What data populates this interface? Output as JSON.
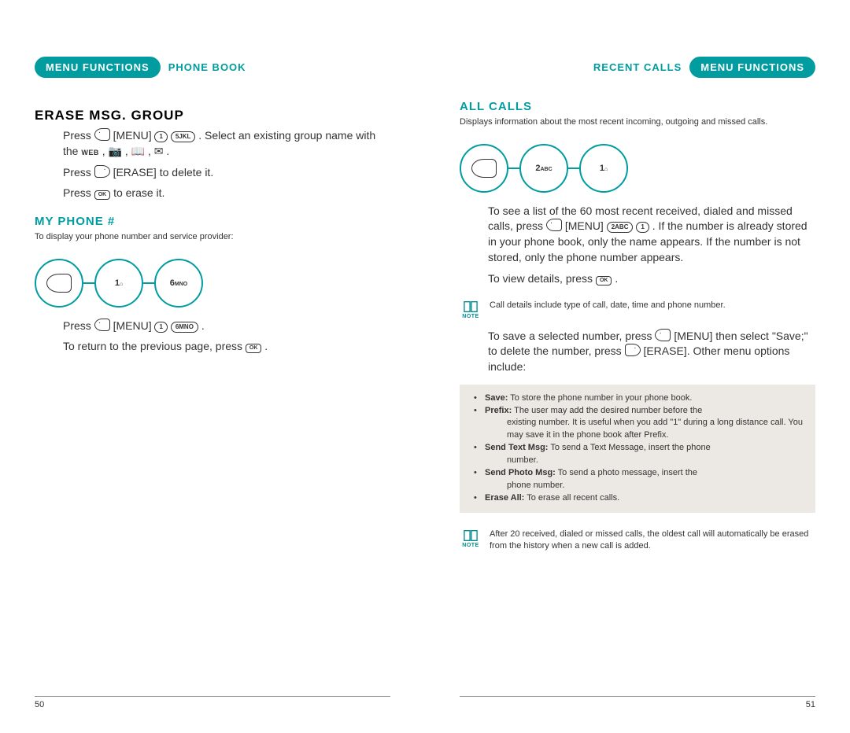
{
  "left": {
    "header_pill": "MENU FUNCTIONS",
    "header_breadcrumb": "PHONE BOOK",
    "s1": {
      "heading": "ERASE MSG. GROUP",
      "line1a": "Press ",
      "menu_word": "[MENU]",
      "line1b": " . Select an existing group name with the ",
      "web": "WEB",
      "line1c": " , ",
      "line2a": "Press ",
      "erase_word": "[ERASE]",
      "line2b": " to delete it.",
      "line3a": "Press ",
      "line3b": " to erase it."
    },
    "s2": {
      "heading": "MY PHONE #",
      "desc": "To display your phone number and service provider:",
      "keys": {
        "k2": "1",
        "k2s": "",
        "k3": "6",
        "k3s": "MNO"
      },
      "line1a": "Press ",
      "menu_word": "[MENU]",
      "line1b": " .",
      "line2a": "To return to the previous page, press ",
      "line2b": " ."
    },
    "page_num": "50"
  },
  "right": {
    "header_breadcrumb": "RECENT CALLS",
    "header_pill": "MENU FUNCTIONS",
    "s1": {
      "heading": "ALL CALLS",
      "desc": "Displays information about the most recent incoming, outgoing and missed calls.",
      "keys": {
        "k2": "2",
        "k2s": "ABC",
        "k3": "1",
        "k3s": ""
      },
      "p1a": "To see a list of the 60 most recent received, dialed and missed calls, press ",
      "menu_word": "[MENU]",
      "p1b": " . If the number is already stored in your phone book, only the name appears. If the number is not stored, only the phone number appears.",
      "p2a": "To view details, press ",
      "p2b": " .",
      "note1": "Call details include type of call, date, time and phone number.",
      "p3a": "To save a selected number, press ",
      "p3b": " [MENU] then select \"Save;\" to delete the number, press ",
      "p3c": " [ERASE].  Other menu options include:",
      "options": {
        "save_b": "Save:",
        "save_t": " To store the phone number in your phone book.",
        "prefix_b": "Prefix:",
        "prefix_t1": " The user may add the desired number before the",
        "prefix_t2": "existing number. It is useful when you add \"1\" during a long distance call. You may save it in the phone book after Prefix.",
        "txt_b": "Send Text Msg:",
        "txt_t1": " To send a Text Message, insert the phone",
        "txt_t2": "number.",
        "photo_b": "Send Photo Msg:",
        "photo_t1": " To send a photo message, insert the",
        "photo_t2": "phone number.",
        "erase_b": "Erase All:",
        "erase_t": " To erase all recent calls."
      },
      "note2": "After 20 received, dialed or missed calls, the oldest call will automatically be erased from the history when a new call is added."
    },
    "page_num": "51"
  },
  "ui": {
    "note_label": "NOTE",
    "ok_label": "OK",
    "key1_full": "1",
    "key5_full": "5JKL",
    "key6_full": "6MNO",
    "key2_full": "2ABC"
  }
}
